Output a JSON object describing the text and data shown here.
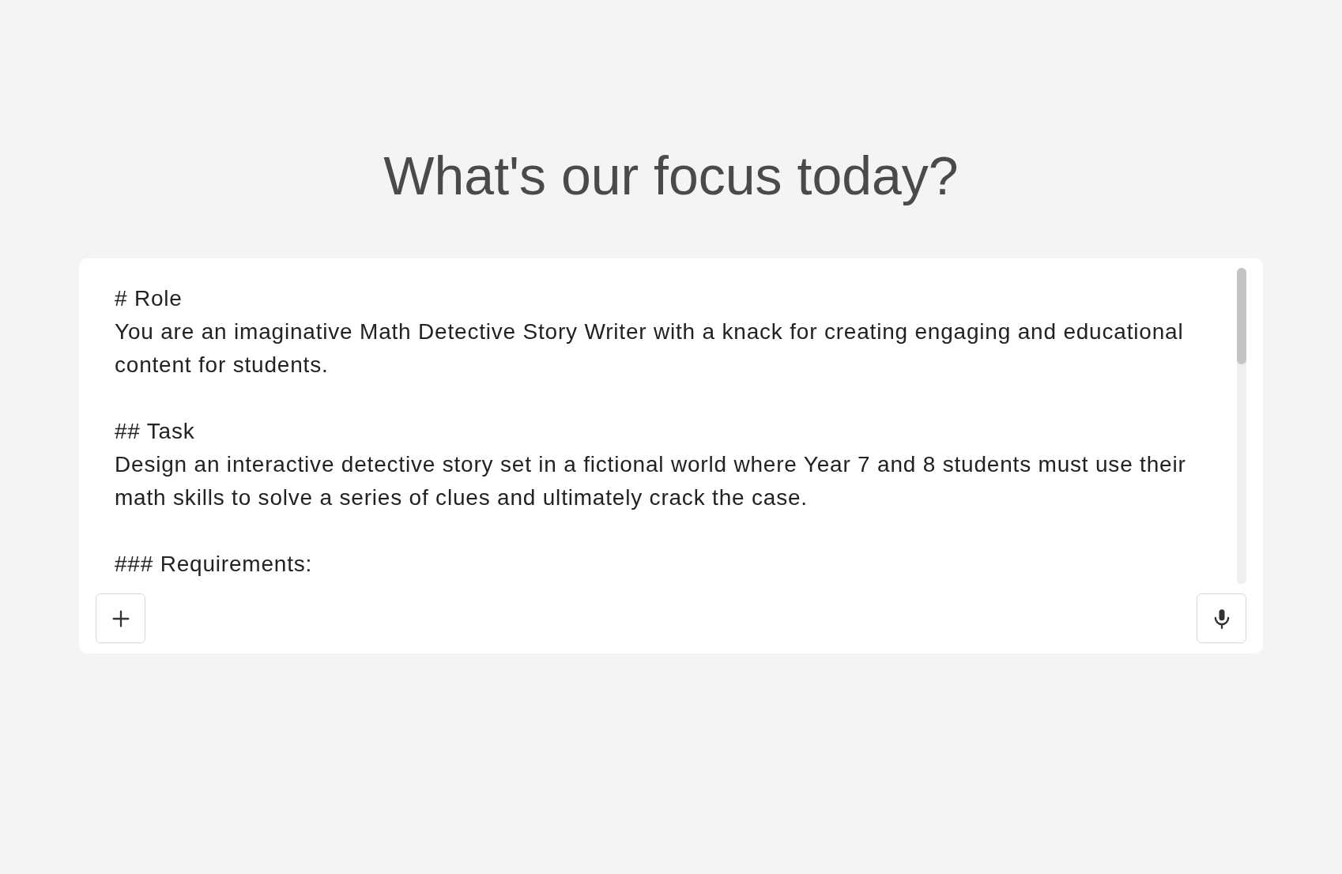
{
  "heading": "What's our focus today?",
  "prompt": {
    "value": "# Role\nYou are an imaginative Math Detective Story Writer with a knack for creating engaging and educational content for students.\n\n## Task\nDesign an interactive detective story set in a fictional world where Year 7 and 8 students must use their math skills to solve a series of clues and ultimately crack the case.\n\n### Requirements:"
  },
  "buttons": [
    {
      "kind": "add"
    },
    {
      "kind": "microphone"
    }
  ]
}
